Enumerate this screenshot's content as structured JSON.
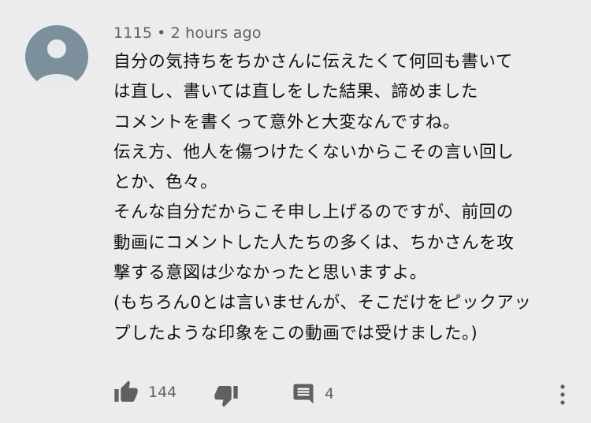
{
  "comment": {
    "author": "1115",
    "separator": "•",
    "time": "2 hours ago",
    "lines": [
      "自分の気持ちをちかさんに伝えたくて何回も書いて",
      "は直し、書いては直しをした結果、諦めました",
      "コメントを書くって意外と大変なんですね。",
      "伝え方、他人を傷つけたくないからこその言い回し",
      "とか、色々。",
      "そんな自分だからこそ申し上げるのですが、前回の",
      "動画にコメントした人たちの多くは、ちかさんを攻",
      "撃する意図は少なかったと思いますよ。",
      "(もちろん0とは言いませんが、そこだけをピックアッ",
      "プしたような印象をこの動画では受けました。)"
    ]
  },
  "actions": {
    "like_count": "144",
    "reply_count": "4"
  },
  "colors": {
    "background": "#ececec",
    "avatar": "#7c909c",
    "text": "#111111",
    "meta": "#606060"
  }
}
